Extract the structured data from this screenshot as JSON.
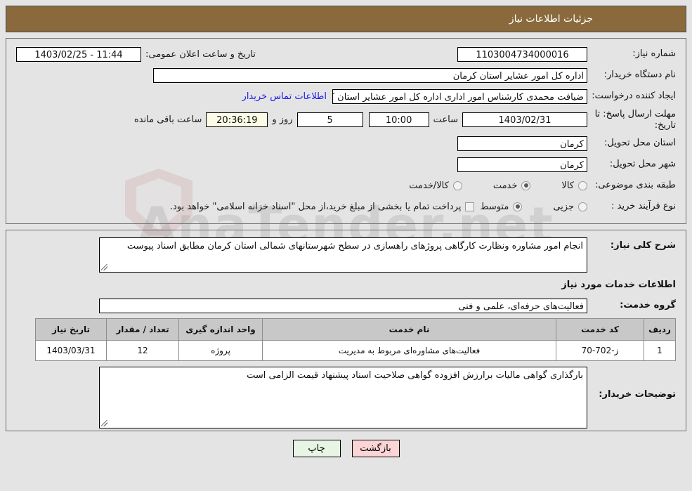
{
  "header": {
    "title": "جزئیات اطلاعات نیاز"
  },
  "form": {
    "need_number_label": "شماره نیاز:",
    "need_number_value": "1103004734000016",
    "announce_label": "تاریخ و ساعت اعلان عمومی:",
    "announce_value": "11:44 - 1403/02/25",
    "buyer_org_label": "نام دستگاه خریدار:",
    "buyer_org_value": "اداره کل امور عشایر استان کرمان",
    "creator_label": "ایجاد کننده درخواست:",
    "creator_value": "ضیافت محمدی کارشناس امور اداری اداره کل امور عشایر استان کرمان",
    "contact_link": "اطلاعات تماس خریدار",
    "deadline_label": "مهلت ارسال پاسخ: تا تاریخ:",
    "deadline_date": "1403/02/31",
    "hour_word": "ساعت",
    "deadline_time": "10:00",
    "days_value": "5",
    "days_word": "روز و",
    "remaining_clock": "20:36:19",
    "remaining_word": "ساعت باقی مانده",
    "province_label": "استان محل تحویل:",
    "province_value": "کرمان",
    "city_label": "شهر محل تحویل:",
    "city_value": "کرمان",
    "category_label": "طبقه بندی موضوعی:",
    "category_options": [
      {
        "label": "کالا",
        "selected": false
      },
      {
        "label": "خدمت",
        "selected": true
      },
      {
        "label": "کالا/خدمت",
        "selected": false
      }
    ],
    "process_label": "نوع فرآیند خرید :",
    "process_options": [
      {
        "label": "جزیی",
        "selected": false
      },
      {
        "label": "متوسط",
        "selected": true
      }
    ],
    "treasury_checkbox_checked": false,
    "treasury_text": "پرداخت تمام یا بخشی از مبلغ خرید،از محل \"اسناد خزانه اسلامی\" خواهد بود."
  },
  "description": {
    "label": "شرح کلی نیاز:",
    "value": "انجام امور مشاوره ونظارت کارگاهی پروژهای راهسازی در سطح شهرستانهای شمالی استان کرمان مطابق اسناد پیوست"
  },
  "services_section": {
    "heading": "اطلاعات خدمات مورد نیاز",
    "group_label": "گروه خدمت:",
    "group_value": "فعالیت‌های حرفه‌ای، علمی و فنی"
  },
  "table": {
    "columns": [
      "ردیف",
      "کد خدمت",
      "نام خدمت",
      "واحد اندازه گیری",
      "تعداد / مقدار",
      "تاریخ نیاز"
    ],
    "rows": [
      {
        "radif": "1",
        "code": "ز-702-70",
        "name": "فعالیت‌های مشاوره‌ای مربوط به مدیریت",
        "unit": "پروژه",
        "qty": "12",
        "date": "1403/03/31"
      }
    ]
  },
  "notes": {
    "label": "توضیحات خریدار:",
    "value": "بارگذاری گواهی مالیات برارزش افزوده گواهی صلاحیت اسناد پیشنهاد قیمت الزامی است"
  },
  "footer": {
    "print_label": "چاپ",
    "back_label": "بازگشت"
  },
  "watermark": {
    "text": "AnaTender.net"
  }
}
